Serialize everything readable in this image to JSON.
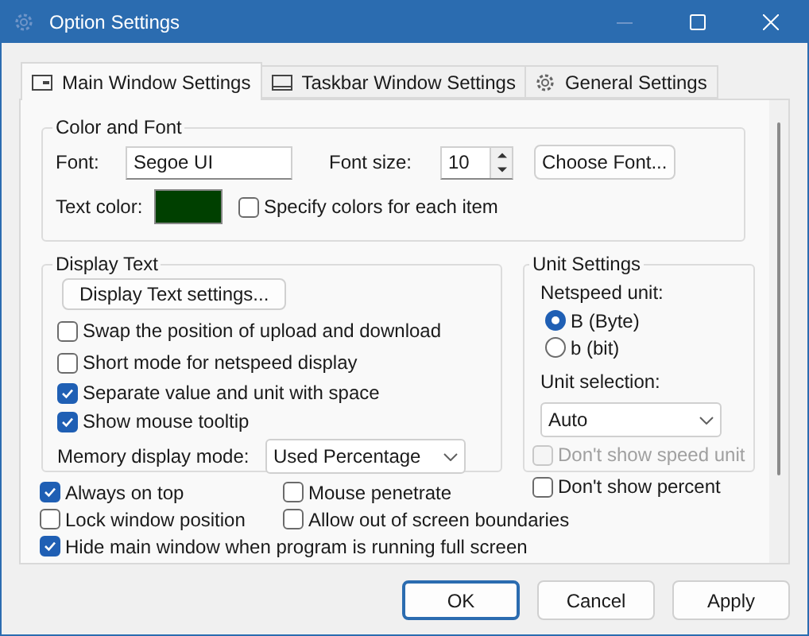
{
  "window": {
    "title": "Option Settings"
  },
  "tabs": [
    {
      "label": "Main Window Settings",
      "selected": true
    },
    {
      "label": "Taskbar Window Settings",
      "selected": false
    },
    {
      "label": "General Settings",
      "selected": false
    }
  ],
  "color_and_font": {
    "title": "Color and Font",
    "font_label": "Font:",
    "font_value": "Segoe UI",
    "font_size_label": "Font size:",
    "font_size_value": "10",
    "choose_font_button": "Choose Font...",
    "text_color_label": "Text color:",
    "text_color": {
      "color": "#004000"
    },
    "specify_colors": {
      "label": "Specify colors for each item",
      "checked": false
    }
  },
  "display_text": {
    "title": "Display Text",
    "settings_button": "Display Text settings...",
    "options": [
      {
        "label": "Swap the position of upload and download",
        "checked": false
      },
      {
        "label": "Short mode for netspeed display",
        "checked": false
      },
      {
        "label": "Separate value and unit with space",
        "checked": true
      },
      {
        "label": "Show mouse tooltip",
        "checked": true
      }
    ],
    "memory_mode_label": "Memory display mode:",
    "memory_mode_value": "Used Percentage"
  },
  "unit_settings": {
    "title": "Unit Settings",
    "netspeed_label": "Netspeed unit:",
    "radios": [
      {
        "label": "B (Byte)",
        "selected": true
      },
      {
        "label": "b (bit)",
        "selected": false
      }
    ],
    "unit_selection_label": "Unit selection:",
    "unit_selection_value": "Auto",
    "options": [
      {
        "label": "Don't show speed unit",
        "checked": false,
        "disabled": true
      },
      {
        "label": "Don't show percent",
        "checked": false,
        "disabled": false
      }
    ]
  },
  "window_options": [
    {
      "label": "Always on top",
      "checked": true
    },
    {
      "label": "Mouse penetrate",
      "checked": false
    },
    {
      "label": "Lock window position",
      "checked": false
    },
    {
      "label": "Allow out of screen boundaries",
      "checked": false
    },
    {
      "label": "Hide main window when program is running full screen",
      "checked": true
    }
  ],
  "buttons": [
    {
      "label": "OK",
      "default": true
    },
    {
      "label": "Cancel",
      "default": false
    },
    {
      "label": "Apply",
      "default": false
    }
  ]
}
